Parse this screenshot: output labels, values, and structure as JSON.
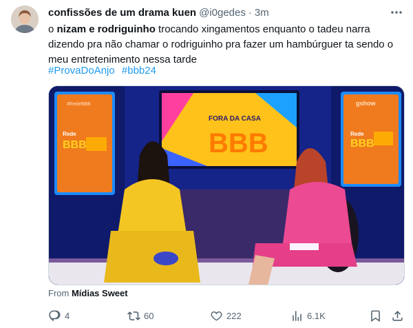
{
  "author": {
    "display_name": "confissões de um drama kuen",
    "handle": "@i0gedes",
    "separator": "·",
    "time": "3m"
  },
  "more_icon": "ellipsis-icon",
  "tweet_text": {
    "prefix": "o ",
    "bold": "nizam e rodriguinho",
    "rest": " trocando xingamentos enquanto o tadeu narra dizendo pra não chamar o rodriguinho pra fazer um hambúrguer ta sendo o meu entretenimento nessa tarde"
  },
  "hashtags": [
    "#ProvaDoAnjo",
    "#bbb24"
  ],
  "media": {
    "screen_title": "FORA DA CASA",
    "screen_logo": "BBB",
    "left_panel_top": "#RedeBBB",
    "left_panel_brand": "Rede",
    "left_panel_logo": "BBB",
    "right_panel_brand": "Rede",
    "right_panel_logo": "BBB",
    "right_panel_top": "gshow"
  },
  "source": {
    "prefix": "From ",
    "name": "Mídias Sweet"
  },
  "actions": {
    "replies": "4",
    "reposts": "60",
    "likes": "222",
    "views": "6.1K"
  },
  "colors": {
    "link": "#1d9bf0",
    "muted": "#536471",
    "text": "#0f1419"
  }
}
